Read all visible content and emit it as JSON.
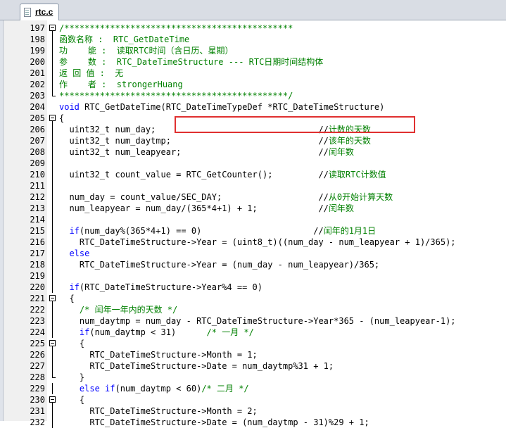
{
  "tab": {
    "label": "rtc.c",
    "icon": "file-icon"
  },
  "colors": {
    "comment": "#008000",
    "keyword": "#0000ff",
    "highlight": "#e03030"
  },
  "lines": [
    {
      "num": "197",
      "fold": "start",
      "segs": [
        {
          "t": "c",
          "s": "/*********************************************"
        }
      ]
    },
    {
      "num": "198",
      "fold": "line",
      "segs": [
        {
          "t": "c",
          "s": "函数名称 :  RTC_GetDateTime"
        }
      ]
    },
    {
      "num": "199",
      "fold": "line",
      "segs": [
        {
          "t": "c",
          "s": "功    能 :  读取RTC时间（含日历、星期）"
        }
      ]
    },
    {
      "num": "200",
      "fold": "line",
      "segs": [
        {
          "t": "c",
          "s": "参    数 :  RTC_DateTimeStructure --- RTC日期时间结构体"
        }
      ]
    },
    {
      "num": "201",
      "fold": "line",
      "segs": [
        {
          "t": "c",
          "s": "返 回 值 :  无"
        }
      ]
    },
    {
      "num": "202",
      "fold": "line",
      "segs": [
        {
          "t": "c",
          "s": "作    者 :  strongerHuang"
        }
      ]
    },
    {
      "num": "203",
      "fold": "end",
      "segs": [
        {
          "t": "c",
          "s": "*********************************************/"
        }
      ]
    },
    {
      "num": "204",
      "fold": "",
      "segs": [
        {
          "t": "k",
          "s": "void"
        },
        {
          "t": "n",
          "s": " RTC_GetDateTime(RTC_DateTimeTypeDef *RTC_DateTimeStructure)"
        }
      ]
    },
    {
      "num": "205",
      "fold": "start",
      "segs": [
        {
          "t": "n",
          "s": "{"
        }
      ]
    },
    {
      "num": "206",
      "fold": "line",
      "segs": [
        {
          "t": "n",
          "s": "  uint32_t num_day;                                //"
        },
        {
          "t": "c",
          "s": "计数的天数"
        }
      ]
    },
    {
      "num": "207",
      "fold": "line",
      "segs": [
        {
          "t": "n",
          "s": "  uint32_t num_daytmp;                             //"
        },
        {
          "t": "c",
          "s": "该年的天数"
        }
      ]
    },
    {
      "num": "208",
      "fold": "line",
      "segs": [
        {
          "t": "n",
          "s": "  uint32_t num_leapyear;                           //"
        },
        {
          "t": "c",
          "s": "闰年数"
        }
      ]
    },
    {
      "num": "209",
      "fold": "line",
      "segs": []
    },
    {
      "num": "210",
      "fold": "line",
      "segs": [
        {
          "t": "n",
          "s": "  uint32_t count_value = RTC_GetCounter();         //"
        },
        {
          "t": "c",
          "s": "读取RTC计数值"
        }
      ]
    },
    {
      "num": "211",
      "fold": "line",
      "segs": []
    },
    {
      "num": "212",
      "fold": "line",
      "segs": [
        {
          "t": "n",
          "s": "  num_day = count_value/SEC_DAY;                   //"
        },
        {
          "t": "c",
          "s": "从0开始计算天数"
        }
      ]
    },
    {
      "num": "213",
      "fold": "line",
      "segs": [
        {
          "t": "n",
          "s": "  num_leapyear = num_day/(365*4+1) + 1;            //"
        },
        {
          "t": "c",
          "s": "闰年数"
        }
      ]
    },
    {
      "num": "214",
      "fold": "line",
      "segs": []
    },
    {
      "num": "215",
      "fold": "line",
      "segs": [
        {
          "t": "k",
          "s": "  if"
        },
        {
          "t": "n",
          "s": "(num_day%(365*4+1) == 0)                      //"
        },
        {
          "t": "c",
          "s": "闰年的1月1日"
        }
      ]
    },
    {
      "num": "216",
      "fold": "line",
      "segs": [
        {
          "t": "n",
          "s": "    RTC_DateTimeStructure->Year = (uint8_t)((num_day - num_leapyear + 1)/365);"
        }
      ]
    },
    {
      "num": "217",
      "fold": "line",
      "segs": [
        {
          "t": "k",
          "s": "  else"
        }
      ]
    },
    {
      "num": "218",
      "fold": "line",
      "segs": [
        {
          "t": "n",
          "s": "    RTC_DateTimeStructure->Year = (num_day - num_leapyear)/365;"
        }
      ]
    },
    {
      "num": "219",
      "fold": "line",
      "segs": []
    },
    {
      "num": "220",
      "fold": "line",
      "segs": [
        {
          "t": "k",
          "s": "  if"
        },
        {
          "t": "n",
          "s": "(RTC_DateTimeStructure->Year%4 == 0)"
        }
      ]
    },
    {
      "num": "221",
      "fold": "start",
      "segs": [
        {
          "t": "n",
          "s": "  {"
        }
      ]
    },
    {
      "num": "222",
      "fold": "line",
      "segs": [
        {
          "t": "c",
          "s": "    /* 闰年一年内的天数 */"
        }
      ]
    },
    {
      "num": "223",
      "fold": "line",
      "segs": [
        {
          "t": "n",
          "s": "    num_daytmp = num_day - RTC_DateTimeStructure->Year*365 - (num_leapyear-1);"
        }
      ]
    },
    {
      "num": "224",
      "fold": "line",
      "segs": [
        {
          "t": "k",
          "s": "    if"
        },
        {
          "t": "n",
          "s": "(num_daytmp < 31)      "
        },
        {
          "t": "c",
          "s": "/* 一月 */"
        }
      ]
    },
    {
      "num": "225",
      "fold": "start",
      "segs": [
        {
          "t": "n",
          "s": "    {"
        }
      ]
    },
    {
      "num": "226",
      "fold": "line",
      "segs": [
        {
          "t": "n",
          "s": "      RTC_DateTimeStructure->Month = 1;"
        }
      ]
    },
    {
      "num": "227",
      "fold": "line",
      "segs": [
        {
          "t": "n",
          "s": "      RTC_DateTimeStructure->Date = num_daytmp%31 + 1;"
        }
      ]
    },
    {
      "num": "228",
      "fold": "end",
      "segs": [
        {
          "t": "n",
          "s": "    }"
        }
      ]
    },
    {
      "num": "229",
      "fold": "line",
      "segs": [
        {
          "t": "k",
          "s": "    else if"
        },
        {
          "t": "n",
          "s": "(num_daytmp < 60)"
        },
        {
          "t": "c",
          "s": "/* 二月 */"
        }
      ]
    },
    {
      "num": "230",
      "fold": "start",
      "segs": [
        {
          "t": "n",
          "s": "    {"
        }
      ]
    },
    {
      "num": "231",
      "fold": "line",
      "segs": [
        {
          "t": "n",
          "s": "      RTC_DateTimeStructure->Month = 2;"
        }
      ]
    },
    {
      "num": "232",
      "fold": "line",
      "segs": [
        {
          "t": "n",
          "s": "      RTC_DateTimeStructure->Date = (num_daytmp - 31)%29 + 1;"
        }
      ]
    }
  ]
}
